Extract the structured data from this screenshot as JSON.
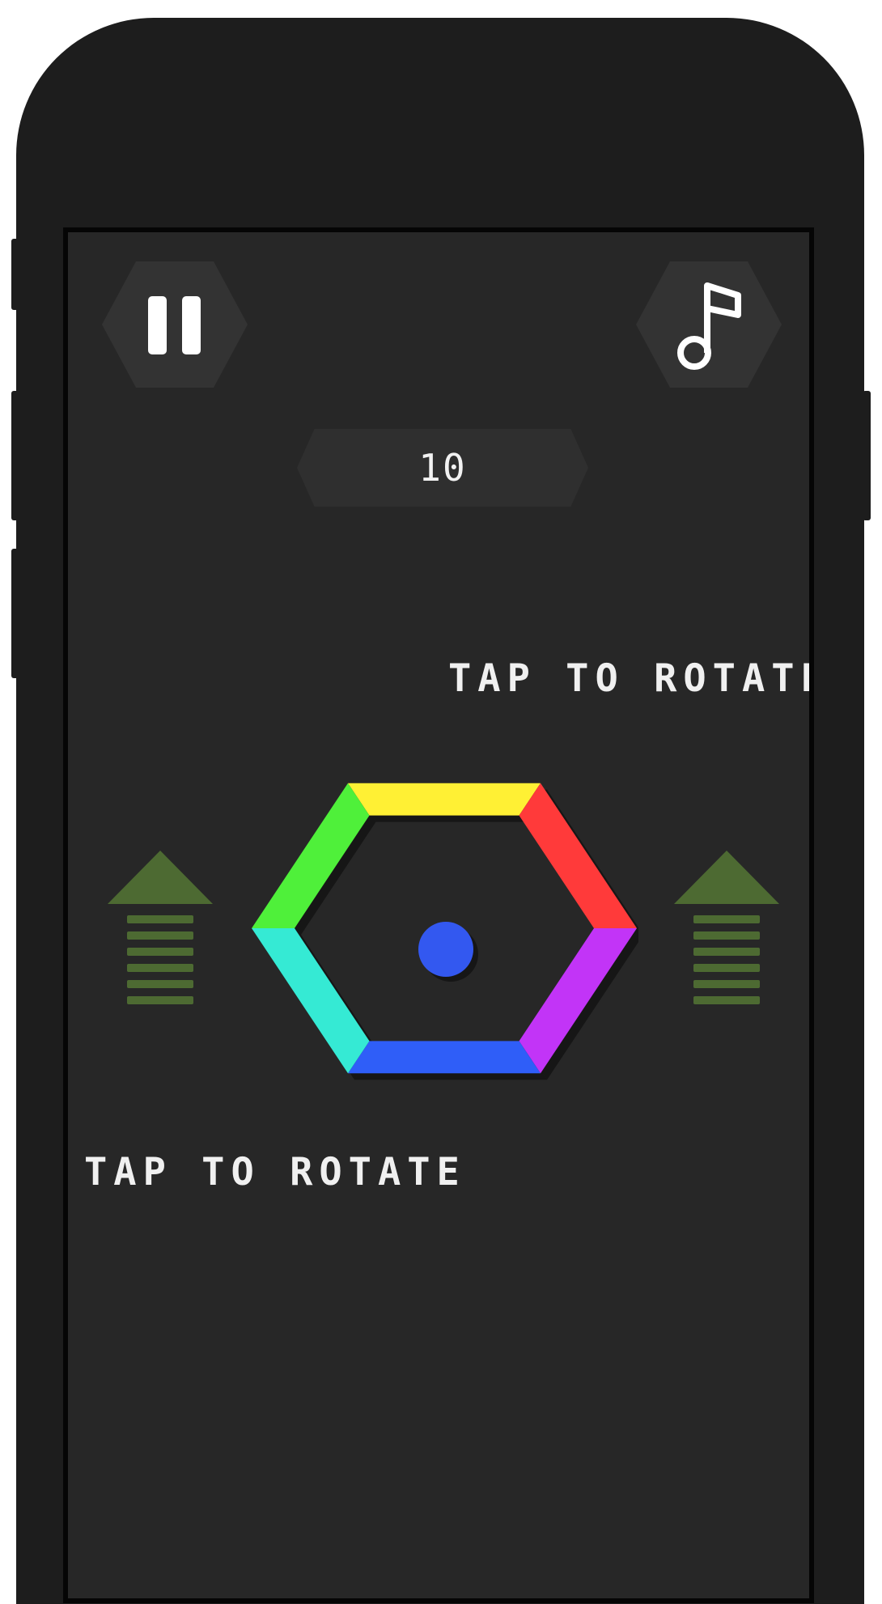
{
  "game": {
    "score": "10",
    "hint_top": "TAP TO ROTATE",
    "hint_bottom": "TAP TO ROTATE"
  },
  "buttons": {
    "pause": {
      "icon": "pause-icon"
    },
    "music": {
      "icon": "music-note-icon"
    }
  },
  "hexagon": {
    "sides": [
      {
        "position": "top",
        "color": "#fff034"
      },
      {
        "position": "top-right",
        "color": "#ff3a3a"
      },
      {
        "position": "bottom-right",
        "color": "#c234f7"
      },
      {
        "position": "bottom",
        "color": "#2f5ef8"
      },
      {
        "position": "bottom-left",
        "color": "#35ead4"
      },
      {
        "position": "top-left",
        "color": "#4ff03a"
      }
    ]
  },
  "ball": {
    "color": "#3358f0"
  },
  "colors": {
    "device": "#1d1d1d",
    "screen": "#272727",
    "button_bg": "#333333",
    "score_bg": "#2f2f2f",
    "arrow": "#4d6a32",
    "text": "#f0f0f0"
  }
}
